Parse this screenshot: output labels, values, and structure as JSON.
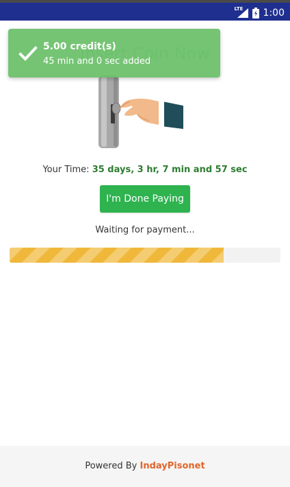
{
  "status_bar": {
    "network_label": "LTE",
    "time": "1:00",
    "background_color": "#1f2f8f"
  },
  "page": {
    "title": "Insert Coin Now"
  },
  "toast": {
    "title": "5.00 credit(s)",
    "message": "45 min and 0 sec added",
    "icon": "check-icon",
    "background_color": "#6abf69"
  },
  "time_info": {
    "label": "Your Time:",
    "value": "35 days, 3 hr, 7 min and 57 sec"
  },
  "actions": {
    "done_label": "I'm Done Paying",
    "done_color": "#2eb34f"
  },
  "payment": {
    "status": "Waiting for payment...",
    "progress_fraction": 0.79,
    "progress_color": "#f0b83a"
  },
  "footer": {
    "prefix": "Powered By",
    "brand": "IndayPisonet",
    "brand_color": "#e0662a"
  }
}
